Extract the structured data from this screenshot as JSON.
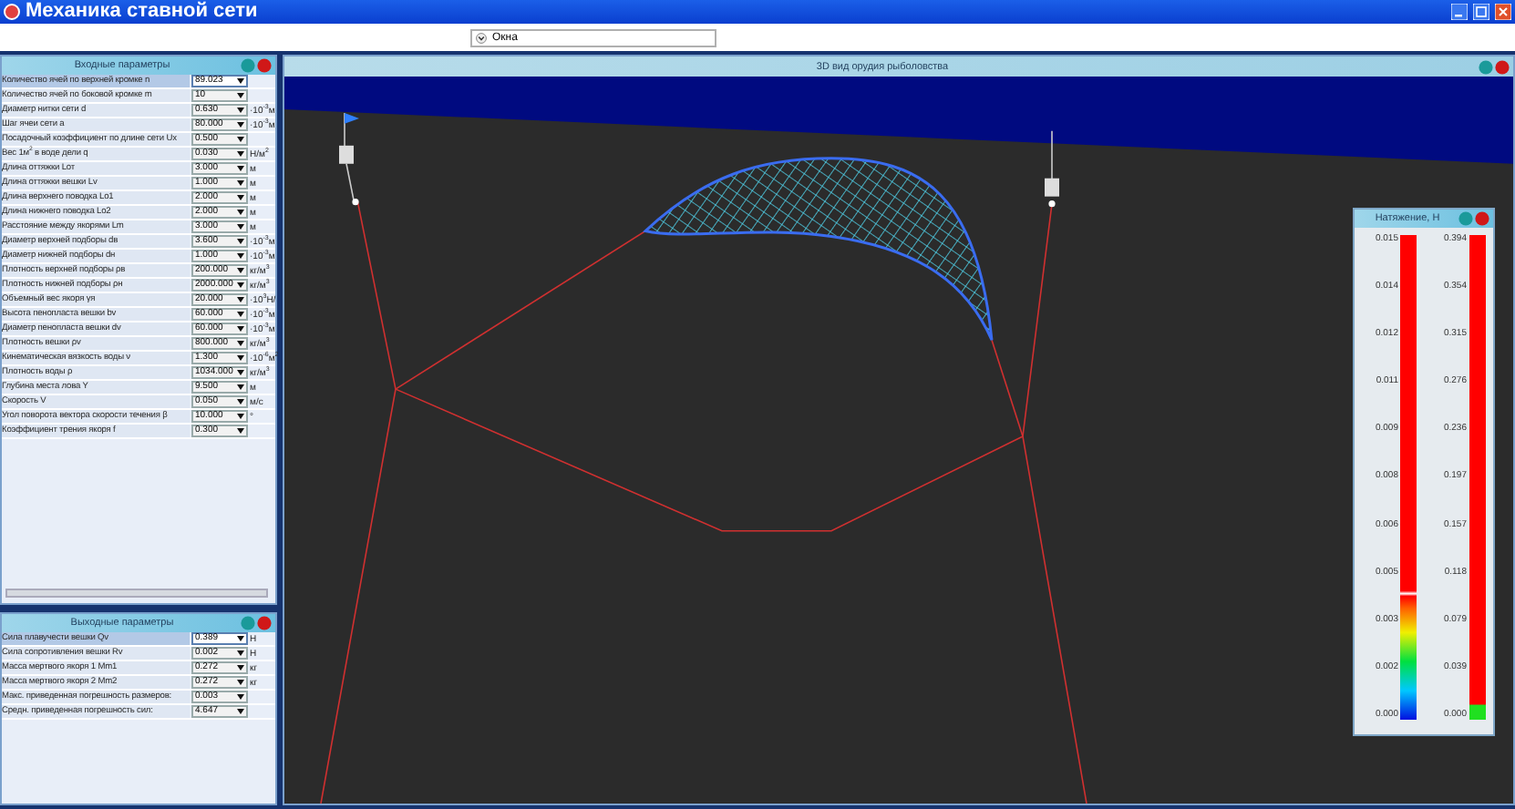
{
  "window": {
    "title": "Механика ставной сети"
  },
  "toolbar": {
    "windows_menu": "Окна"
  },
  "input_panel": {
    "title": "Входные параметры",
    "rows": [
      {
        "label": "Количество ячей по верхней кромке n",
        "value": "89.023",
        "selected": true
      },
      {
        "label": "Количество ячей по боковой кромке m",
        "value": "10",
        "selected": false
      },
      {
        "label": "Диаметр нитки сети d",
        "value": "0.630",
        "unit": "·10$^{-3}$м",
        "selected": false
      },
      {
        "label": "Шаг ячеи сети a",
        "value": "80.000",
        "unit": "·10$^{-3}$м",
        "selected": false
      },
      {
        "label": "Посадочный коэффициент по длине сети Ux",
        "value": "0.500",
        "selected": false
      },
      {
        "label": "Вес 1м$^{2}$ в воде дели q",
        "value": "0.030",
        "unit": "Н/м$^{2}$",
        "selected": false
      },
      {
        "label": "Длина оттяжки Lот",
        "value": "3.000",
        "unit": "м",
        "selected": false
      },
      {
        "label": "Длина оттяжки вешки Lv",
        "value": "1.000",
        "unit": "м",
        "selected": false
      },
      {
        "label": "Длина верхнего поводка Lo1",
        "value": "2.000",
        "unit": "м",
        "selected": false
      },
      {
        "label": "Длина нижнего поводка Lo2",
        "value": "2.000",
        "unit": "м",
        "selected": false
      },
      {
        "label": "Расстояние между якорями Lm",
        "value": "3.000",
        "unit": "м",
        "selected": false
      },
      {
        "label": "Диаметр верхней подборы dв",
        "value": "3.600",
        "unit": "·10$^{-3}$м",
        "selected": false
      },
      {
        "label": "Диаметр нижней подборы dн",
        "value": "1.000",
        "unit": "·10$^{-3}$м",
        "selected": false
      },
      {
        "label": "Плотность верхней подборы ρв",
        "value": "200.000",
        "unit": "кг/м$^{3}$",
        "selected": false
      },
      {
        "label": "Плотность нижней подборы ρн",
        "value": "2000.000",
        "unit": "кг/м$^{3}$",
        "selected": false
      },
      {
        "label": "Объемный вес якоря γя",
        "value": "20.000",
        "unit": "·10$^{3}$Н/",
        "selected": false
      },
      {
        "label": "Высота пенопласта вешки bv",
        "value": "60.000",
        "unit": "·10$^{-3}$м",
        "selected": false
      },
      {
        "label": "Диаметр пенопласта вешки dv",
        "value": "60.000",
        "unit": "·10$^{-3}$м",
        "selected": false
      },
      {
        "label": "Плотность вешки ρv",
        "value": "800.000",
        "unit": "кг/м$^{3}$",
        "selected": false
      },
      {
        "label": "Кинематическая вязкость воды ν",
        "value": "1.300",
        "unit": "·10$^{-6}$м$^{2}$",
        "selected": false
      },
      {
        "label": "Плотность воды ρ",
        "value": "1034.000",
        "unit": "кг/м$^{3}$",
        "selected": false
      },
      {
        "label": "Глубина места лова Y",
        "value": "9.500",
        "unit": "м",
        "selected": false
      },
      {
        "label": "Скорость V",
        "value": "0.050",
        "unit": "м/с",
        "selected": false
      },
      {
        "label": "Угол поворота вектора скорости течения β",
        "value": "10.000",
        "unit": "°",
        "selected": false
      },
      {
        "label": "Коэффициент трения якоря f",
        "value": "0.300",
        "selected": false
      }
    ]
  },
  "output_panel": {
    "title": "Выходные параметры",
    "rows": [
      {
        "label": "Сила плавучести вешки Qv",
        "value": "0.389",
        "unit": "Н",
        "selected": true
      },
      {
        "label": "Сила сопротивления вешки Rv",
        "value": "0.002",
        "unit": "Н",
        "selected": false
      },
      {
        "label": "Масса мертвого якоря 1 Mm1",
        "value": "0.272",
        "unit": "кг",
        "selected": false
      },
      {
        "label": "Масса мертвого якоря 2 Mm2",
        "value": "0.272",
        "unit": "кг",
        "selected": false
      },
      {
        "label": "Макс. приведенная погрешность размеров:",
        "value": "0.003",
        "selected": false
      },
      {
        "label": "Средн. приведенная погрешность сил:",
        "value": "4.647",
        "selected": false
      }
    ]
  },
  "view": {
    "title": "3D вид орудия рыболовства",
    "legend": {
      "title": "Натяжение, Н",
      "scales": [
        {
          "kind": "spectrum",
          "ticks": [
            "0.015",
            "0.014",
            "0.012",
            "0.011",
            "0.009",
            "0.008",
            "0.006",
            "0.005",
            "0.003",
            "0.002",
            "0.000"
          ]
        },
        {
          "kind": "two-tone",
          "ticks": [
            "0.394",
            "0.354",
            "0.315",
            "0.276",
            "0.236",
            "0.197",
            "0.157",
            "0.118",
            "0.079",
            "0.039",
            "0.000"
          ]
        }
      ]
    }
  }
}
